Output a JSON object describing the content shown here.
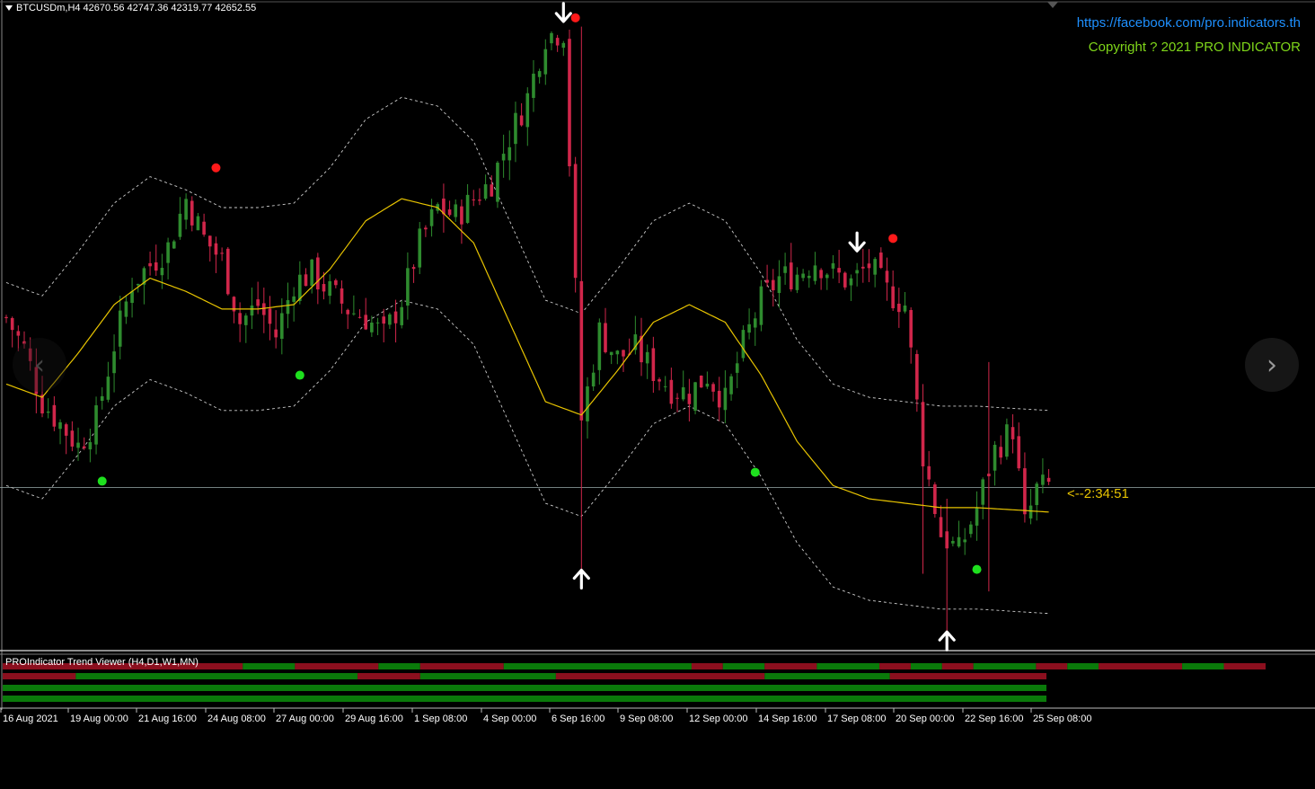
{
  "header": {
    "symbol_info": "BTCUSDm,H4  42670.56 42747.36 42319.77 42652.55"
  },
  "overlay": {
    "link": "https://facebook.com/pro.indicators.th",
    "copyright": "Copyright ? 2021 PRO INDICATOR",
    "timer": "<--2:34:51"
  },
  "subwindow": {
    "title": "PROIndicator Trend Viewer (H4,D1,W1,MN)"
  },
  "nav": {
    "prev": "‹",
    "next": "›"
  },
  "colors": {
    "background": "#000000",
    "bull": "#2e8b2e",
    "bear": "#d0264a",
    "midline": "#e8c400",
    "band": "#cccccc",
    "dot_sell": "#ff1a1a",
    "dot_buy": "#1ee01e",
    "trend_up": "#0a7a0a",
    "trend_down": "#8b0f1e"
  },
  "chart_data": {
    "type": "candlestick",
    "x_ticks": [
      "16 Aug 2021",
      "19 Aug 00:00",
      "21 Aug 16:00",
      "24 Aug 08:00",
      "27 Aug 00:00",
      "29 Aug 16:00",
      "1 Sep 08:00",
      "4 Sep 00:00",
      "6 Sep 16:00",
      "9 Sep 08:00",
      "12 Sep 00:00",
      "14 Sep 16:00",
      "17 Sep 08:00",
      "20 Sep 00:00",
      "22 Sep 16:00",
      "25 Sep 08:00"
    ],
    "price_range": [
      39000,
      53500
    ],
    "close_path": [
      [
        0,
        46500
      ],
      [
        3,
        45800
      ],
      [
        6,
        44600
      ],
      [
        9,
        44100
      ],
      [
        12,
        43600
      ],
      [
        15,
        44200
      ],
      [
        18,
        45900
      ],
      [
        21,
        47300
      ],
      [
        24,
        47700
      ],
      [
        27,
        48100
      ],
      [
        30,
        49200
      ],
      [
        33,
        48300
      ],
      [
        36,
        47800
      ],
      [
        39,
        46400
      ],
      [
        42,
        46800
      ],
      [
        45,
        46100
      ],
      [
        48,
        47300
      ],
      [
        51,
        47500
      ],
      [
        54,
        47100
      ],
      [
        57,
        46700
      ],
      [
        60,
        46500
      ],
      [
        63,
        46100
      ],
      [
        66,
        46900
      ],
      [
        69,
        48200
      ],
      [
        72,
        49000
      ],
      [
        75,
        48800
      ],
      [
        78,
        49200
      ],
      [
        81,
        49600
      ],
      [
        84,
        50600
      ],
      [
        87,
        51500
      ],
      [
        90,
        52900
      ],
      [
        93,
        53000
      ],
      [
        96,
        44200
      ],
      [
        99,
        46200
      ],
      [
        102,
        45600
      ],
      [
        105,
        45800
      ],
      [
        108,
        45300
      ],
      [
        111,
        44900
      ],
      [
        114,
        44800
      ],
      [
        117,
        45200
      ],
      [
        120,
        44600
      ],
      [
        123,
        45900
      ],
      [
        126,
        46900
      ],
      [
        129,
        47400
      ],
      [
        132,
        47500
      ],
      [
        135,
        47800
      ],
      [
        138,
        47500
      ],
      [
        141,
        47300
      ],
      [
        144,
        47700
      ],
      [
        147,
        47100
      ],
      [
        150,
        46800
      ],
      [
        153,
        43400
      ],
      [
        156,
        41600
      ],
      [
        159,
        41200
      ],
      [
        162,
        42200
      ],
      [
        165,
        43500
      ],
      [
        168,
        44000
      ],
      [
        170,
        41800
      ],
      [
        172,
        42600
      ],
      [
        174,
        42700
      ]
    ],
    "middle_line": [
      [
        0,
        45000
      ],
      [
        6,
        44700
      ],
      [
        12,
        45700
      ],
      [
        18,
        46800
      ],
      [
        24,
        47400
      ],
      [
        30,
        47100
      ],
      [
        36,
        46700
      ],
      [
        42,
        46700
      ],
      [
        48,
        46800
      ],
      [
        54,
        47600
      ],
      [
        60,
        48700
      ],
      [
        66,
        49200
      ],
      [
        72,
        49000
      ],
      [
        78,
        48200
      ],
      [
        84,
        46400
      ],
      [
        90,
        44600
      ],
      [
        96,
        44300
      ],
      [
        102,
        45300
      ],
      [
        108,
        46400
      ],
      [
        114,
        46800
      ],
      [
        120,
        46400
      ],
      [
        126,
        45200
      ],
      [
        132,
        43700
      ],
      [
        138,
        42700
      ],
      [
        144,
        42400
      ],
      [
        150,
        42300
      ],
      [
        156,
        42200
      ],
      [
        162,
        42200
      ],
      [
        168,
        42150
      ],
      [
        174,
        42100
      ]
    ],
    "band_offset": 2300,
    "signals": [
      {
        "bar": 93,
        "type": "sell_arrow",
        "price": 53400
      },
      {
        "bar": 95,
        "type": "sell_dot",
        "price": 53300
      },
      {
        "bar": 96,
        "type": "buy_arrow",
        "price": 40600
      },
      {
        "bar": 35,
        "type": "sell_dot",
        "price": 49900
      },
      {
        "bar": 142,
        "type": "sell_arrow",
        "price": 48200
      },
      {
        "bar": 148,
        "type": "sell_dot",
        "price": 48300
      },
      {
        "bar": 157,
        "type": "buy_arrow",
        "price": 39200
      },
      {
        "bar": 16,
        "type": "buy_dot",
        "price": 42800
      },
      {
        "bar": 49,
        "type": "buy_dot",
        "price": 45200
      },
      {
        "bar": 125,
        "type": "buy_dot",
        "price": 43000
      },
      {
        "bar": 162,
        "type": "buy_dot",
        "price": 40800
      }
    ],
    "current_price": 42652.55,
    "trend_viewer": {
      "rows": [
        "H4",
        "D1",
        "W1",
        "MN"
      ],
      "segments": [
        [
          [
            "d",
            0.23
          ],
          [
            "u",
            0.05
          ],
          [
            "d",
            0.08
          ],
          [
            "u",
            0.04
          ],
          [
            "d",
            0.08
          ],
          [
            "u",
            0.18
          ],
          [
            "d",
            0.03
          ],
          [
            "u",
            0.04
          ],
          [
            "d",
            0.05
          ],
          [
            "u",
            0.06
          ],
          [
            "d",
            0.03
          ],
          [
            "u",
            0.03
          ],
          [
            "d",
            0.03
          ],
          [
            "u",
            0.06
          ],
          [
            "d",
            0.03
          ],
          [
            "u",
            0.03
          ],
          [
            "d",
            0.08
          ],
          [
            "u",
            0.04
          ],
          [
            "d",
            0.04
          ]
        ],
        [
          [
            "d",
            0.07
          ],
          [
            "u",
            0.27
          ],
          [
            "d",
            0.06
          ],
          [
            "u",
            0.13
          ],
          [
            "d",
            0.2
          ],
          [
            "u",
            0.12
          ],
          [
            "d",
            0.15
          ]
        ],
        [
          [
            "u",
            1.0
          ]
        ],
        [
          [
            "u",
            1.0
          ]
        ]
      ]
    }
  }
}
